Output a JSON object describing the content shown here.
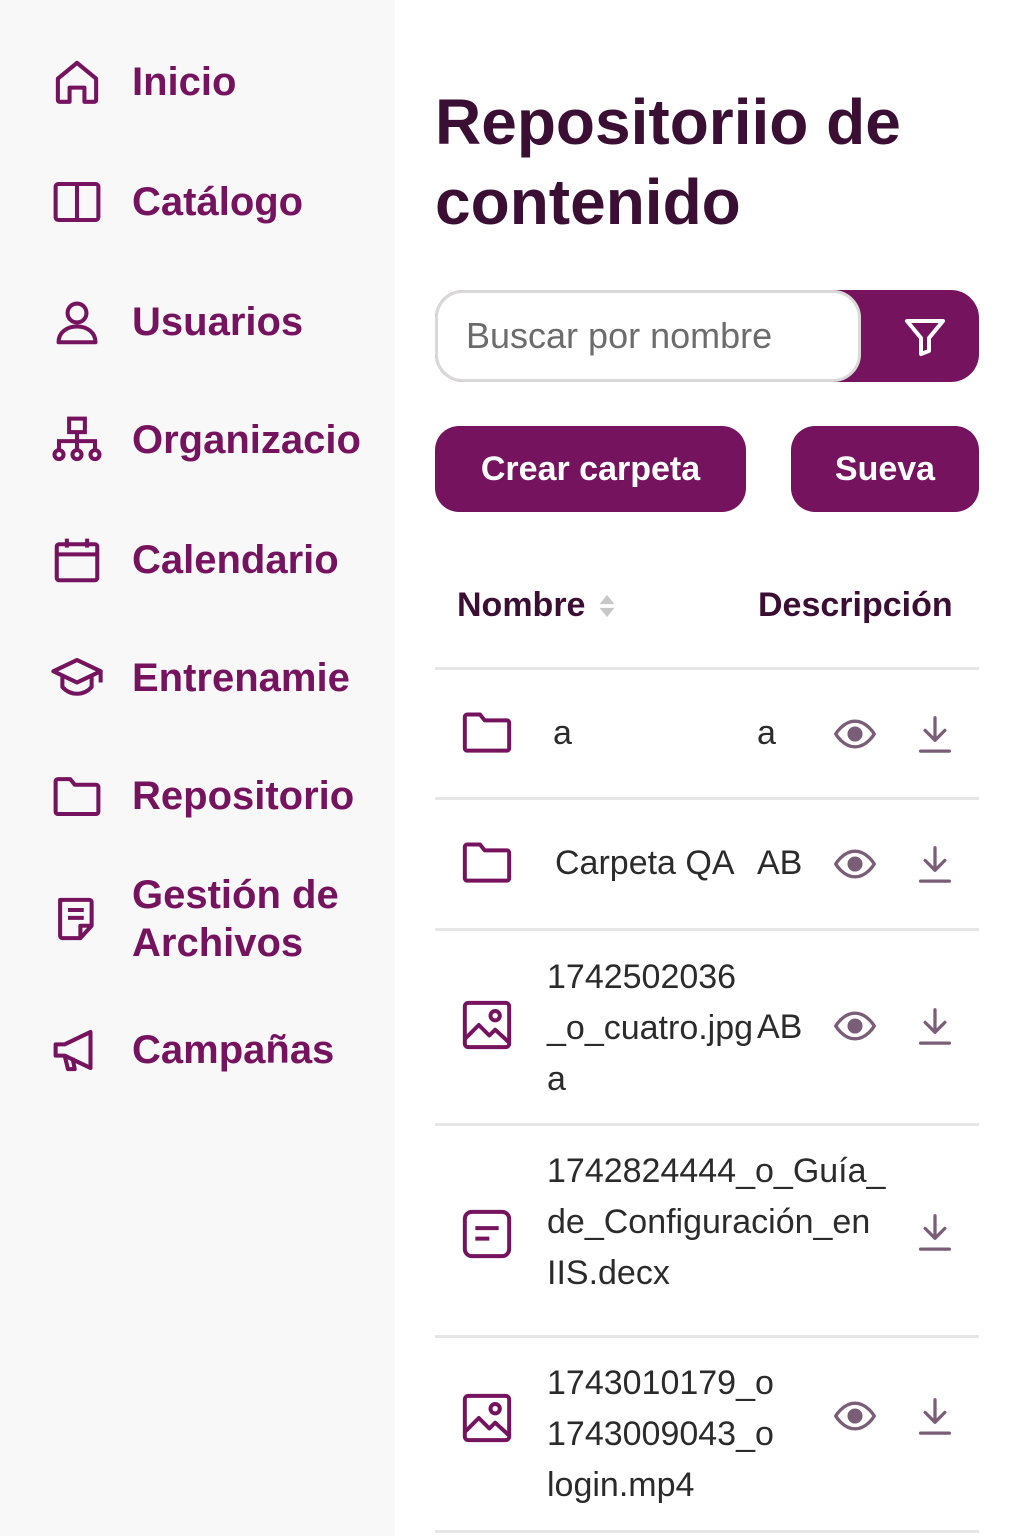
{
  "sidebar": {
    "items": [
      {
        "label": "Inicio",
        "icon": "home-icon"
      },
      {
        "label": "Catálogo",
        "icon": "book-open-icon"
      },
      {
        "label": "Usuarios",
        "icon": "user-icon"
      },
      {
        "label": "Organizacio",
        "icon": "org-chart-icon"
      },
      {
        "label": "Calendario",
        "icon": "calendar-icon"
      },
      {
        "label": "Entrenamie",
        "icon": "graduation-cap-icon"
      },
      {
        "label": "Repositorio",
        "icon": "folder-icon"
      },
      {
        "label": "Gestión de\nArchivos",
        "icon": "file-text-icon"
      },
      {
        "label": "Campañas",
        "icon": "megaphone-icon"
      }
    ]
  },
  "main": {
    "title": "Repositoriio de contenido",
    "search": {
      "placeholder": "Buscar por nombre",
      "value": ""
    },
    "buttons": {
      "create_folder": "Crear carpeta",
      "new": "Sueva"
    },
    "table": {
      "columns": {
        "name": "Nombre",
        "description": "Descripción"
      },
      "rows": [
        {
          "icon": "folder-icon",
          "name": "a",
          "description": "a",
          "has_view": true,
          "has_download": true
        },
        {
          "icon": "folder-icon",
          "name": "Carpeta QA",
          "description": "AB",
          "has_view": true,
          "has_download": true
        },
        {
          "icon": "image-icon",
          "name": "1742502036\n_o_cuatro.jpg\na",
          "description": "AB",
          "has_view": true,
          "has_download": true
        },
        {
          "icon": "document-icon",
          "name": "1742824444_o_Guía_\nde_Configuración_en\nIIS.decx",
          "description": "",
          "has_view": false,
          "has_download": true
        },
        {
          "icon": "image-icon",
          "name": "1743010179_o\n1743009043_o\nlogin.mp4",
          "description": "",
          "has_view": true,
          "has_download": true
        }
      ]
    }
  },
  "colors": {
    "accent": "#76135f",
    "title": "#3b0e34",
    "sidebar_bg": "#f8f8f8",
    "divider": "#e6e6e6"
  }
}
